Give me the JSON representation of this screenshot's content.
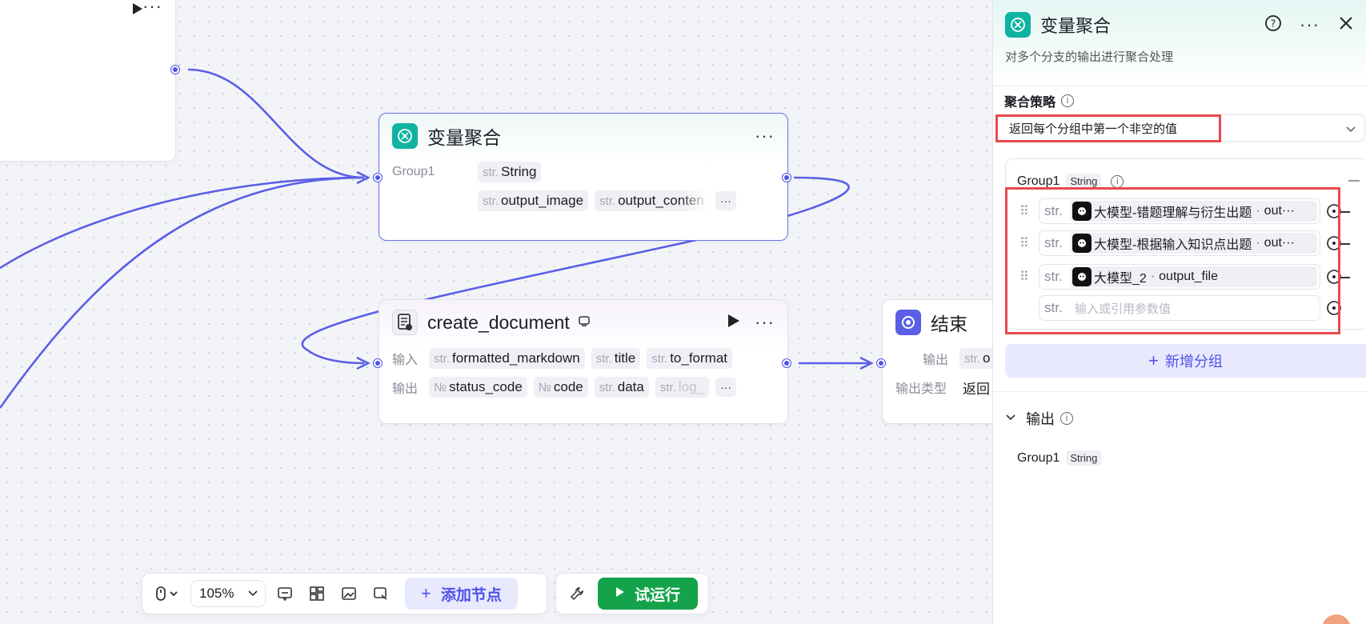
{
  "canvas": {
    "top_node": {
      "run_icon": "play-icon",
      "more_icon": "more-icon"
    },
    "aggregate_node": {
      "title": "变量聚合",
      "group_label": "Group1",
      "group_type": {
        "type": "str.",
        "name": "String"
      },
      "vars": [
        {
          "type": "str.",
          "name": "output_image"
        },
        {
          "type": "str.",
          "name": "output_conten"
        }
      ],
      "more": "···"
    },
    "create_doc_node": {
      "title": "create_document",
      "input_label": "输入",
      "output_label": "输出",
      "inputs": [
        {
          "type": "str.",
          "name": "formatted_markdown"
        },
        {
          "type": "str.",
          "name": "title"
        },
        {
          "type": "str.",
          "name": "to_format"
        }
      ],
      "outputs": [
        {
          "type": "№",
          "name": "status_code"
        },
        {
          "type": "№",
          "name": "code"
        },
        {
          "type": "str.",
          "name": "data"
        },
        {
          "type": "str.",
          "name": "log_"
        }
      ],
      "more": "···"
    },
    "end_node": {
      "title": "结束",
      "output_label": "输出",
      "output_var": {
        "type": "str.",
        "name": "o"
      },
      "output_type_label": "输出类型",
      "output_type_value": "返回"
    }
  },
  "toolbar": {
    "zoom": "105%",
    "add_node": "添加节点",
    "run": "试运行"
  },
  "panel": {
    "title": "变量聚合",
    "description": "对多个分支的输出进行聚合处理",
    "strategy_label": "聚合策略",
    "strategy_value": "返回每个分组中第一个非空的值",
    "group": {
      "name": "Group1",
      "type": "String",
      "items": [
        {
          "type": "str.",
          "source": "大模型-错题理解与衍生出题",
          "var": "out···"
        },
        {
          "type": "str.",
          "source": "大模型-根据输入知识点出题",
          "var": "out···"
        },
        {
          "type": "str.",
          "source": "大模型_2",
          "var": "output_file"
        }
      ],
      "empty_type": "str.",
      "placeholder": "输入或引用参数值"
    },
    "add_group": "新增分组",
    "output_label": "输出",
    "output_group": "Group1",
    "output_type": "String"
  },
  "colors": {
    "accent": "#4d53e8",
    "run_green": "#14a34a",
    "highlight_red": "#e8484e",
    "teal_icon": "#0fb3a2"
  }
}
